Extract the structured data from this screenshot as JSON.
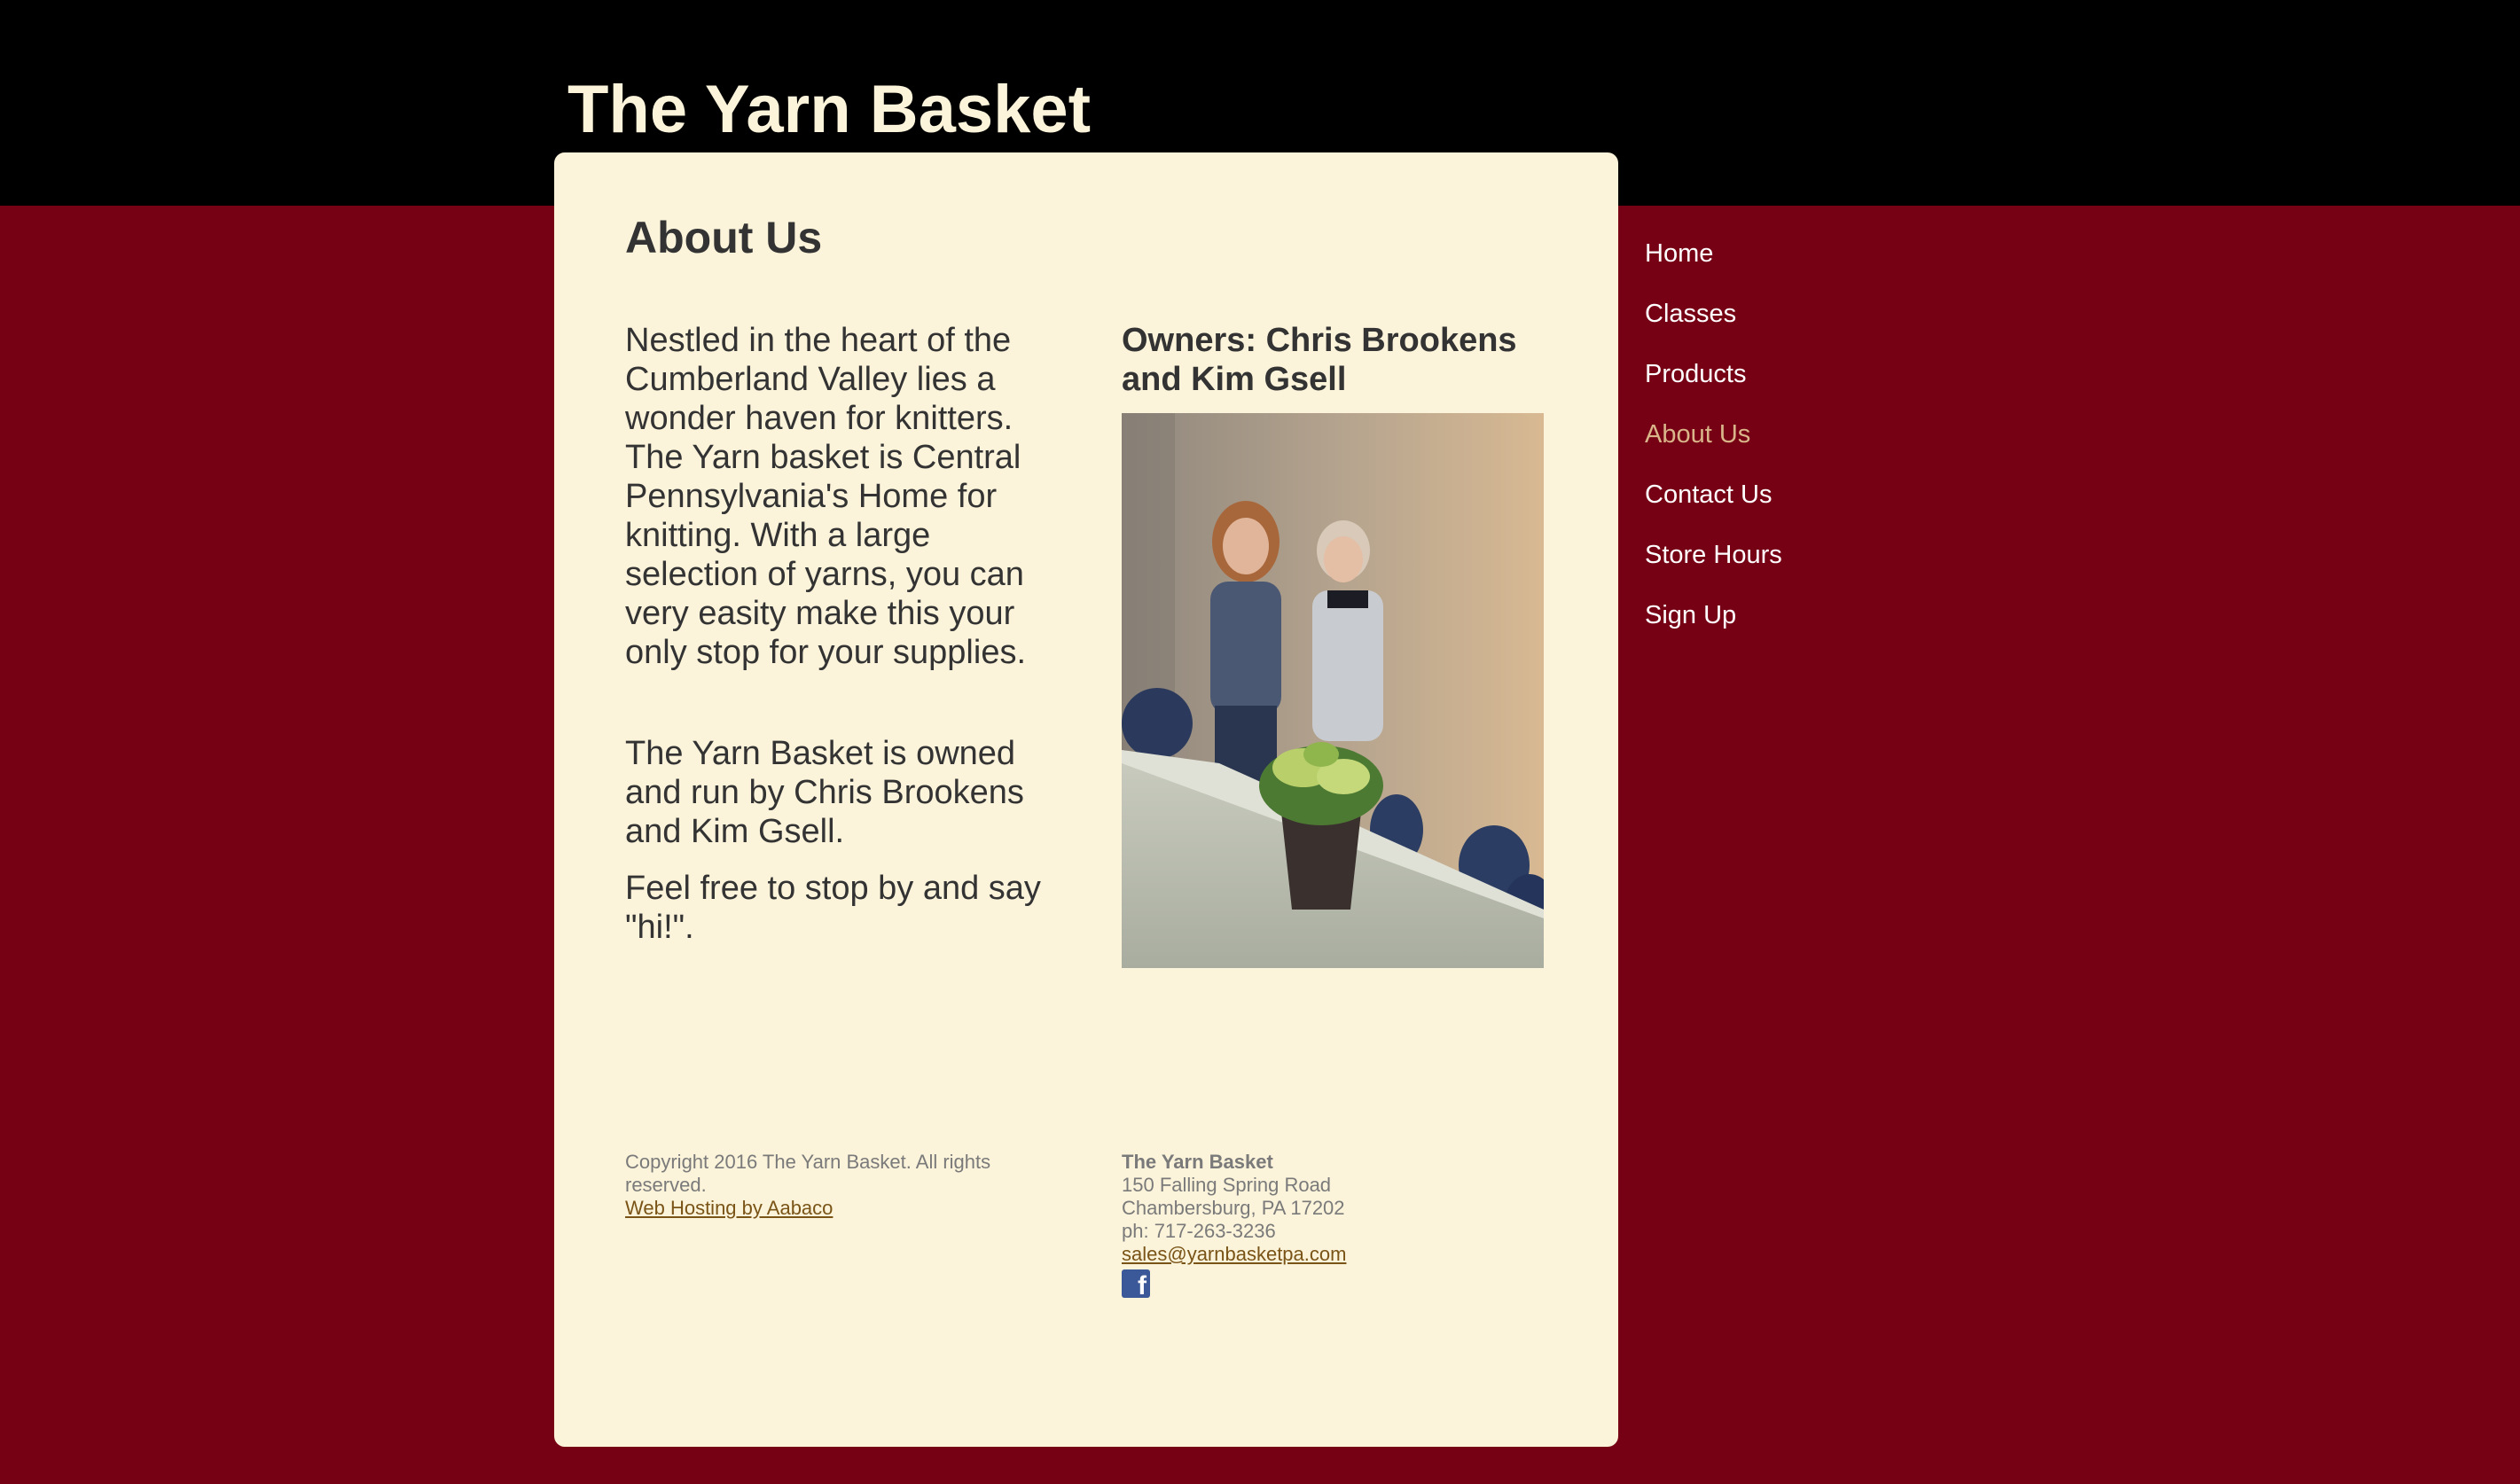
{
  "site": {
    "title": "The Yarn Basket"
  },
  "page": {
    "heading": "About Us",
    "paragraphs": [
      "Nestled in the heart of the Cumberland Valley lies a wonder haven for knitters.  The Yarn basket is Central Pennsylvania's Home for knitting.  With a large selection of yarns, you can very easity make this your only stop for your supplies.",
      "The Yarn Basket is owned and run by Chris Brookens and Kim Gsell.",
      "Feel free to stop by and say \"hi!\"."
    ],
    "owners_heading": "Owners: Chris Brookens and Kim Gsell"
  },
  "nav": {
    "items": [
      {
        "label": "Home"
      },
      {
        "label": "Classes"
      },
      {
        "label": "Products"
      },
      {
        "label": "About Us"
      },
      {
        "label": "Contact Us"
      },
      {
        "label": "Store Hours"
      },
      {
        "label": "Sign Up"
      }
    ],
    "active": "About Us"
  },
  "footer": {
    "copyright": "Copyright 2016 The Yarn Basket. All rights reserved.",
    "hosting_link": "Web Hosting by Aabaco",
    "business_name": "The Yarn Basket",
    "address_line1": "150 Falling Spring Road",
    "address_line2": "Chambersburg, PA 17202",
    "phone": "ph: 717-263-3236",
    "email": "sales@yarnbasketpa.com",
    "social_icon": "facebook-icon"
  },
  "colors": {
    "background": "#760014",
    "header": "#000000",
    "panel": "#fbf3da",
    "title": "#fbf3da",
    "nav_text": "#ffffff",
    "nav_active": "#d9b58a",
    "link": "#7a5417"
  }
}
